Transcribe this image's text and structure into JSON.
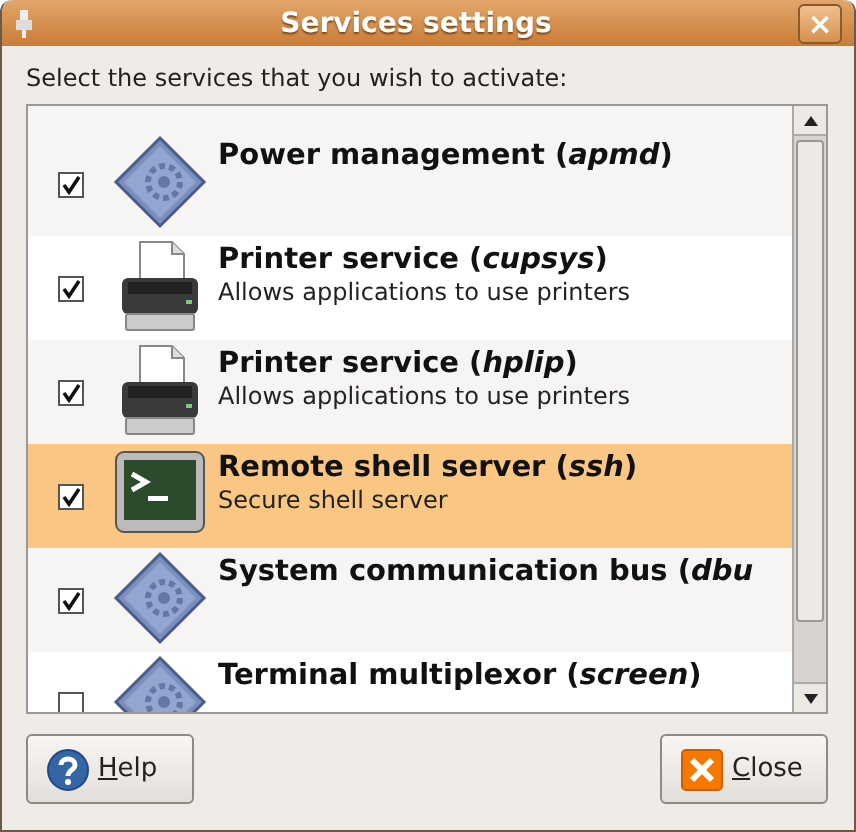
{
  "window": {
    "title": "Services settings",
    "close": "×"
  },
  "instruction": "Select the services that you wish to activate:",
  "services": [
    {
      "kind": "gear",
      "name": "Power management (*apmd*)",
      "checked": true,
      "selected": false
    },
    {
      "kind": "printer",
      "name": "Printer service (*cupsys*)",
      "description": "Allows applications to use printers",
      "checked": true,
      "selected": false
    },
    {
      "kind": "printer",
      "name": "Printer service (*hplip*)",
      "description": "Allows applications to use printers",
      "checked": true,
      "selected": false
    },
    {
      "kind": "terminal",
      "name": "Remote shell server (*ssh*)",
      "description": "Secure shell server",
      "checked": true,
      "selected": true
    },
    {
      "kind": "gear",
      "name": "System communication bus (*dbu*",
      "checked": true,
      "selected": false
    },
    {
      "kind": "gear",
      "name": "Terminal multiplexor (*screen*)",
      "checked": false,
      "selected": false
    }
  ],
  "buttons": [
    {
      "kind": "help",
      "label": "Help"
    },
    {
      "kind": "close",
      "label": "Close"
    }
  ]
}
